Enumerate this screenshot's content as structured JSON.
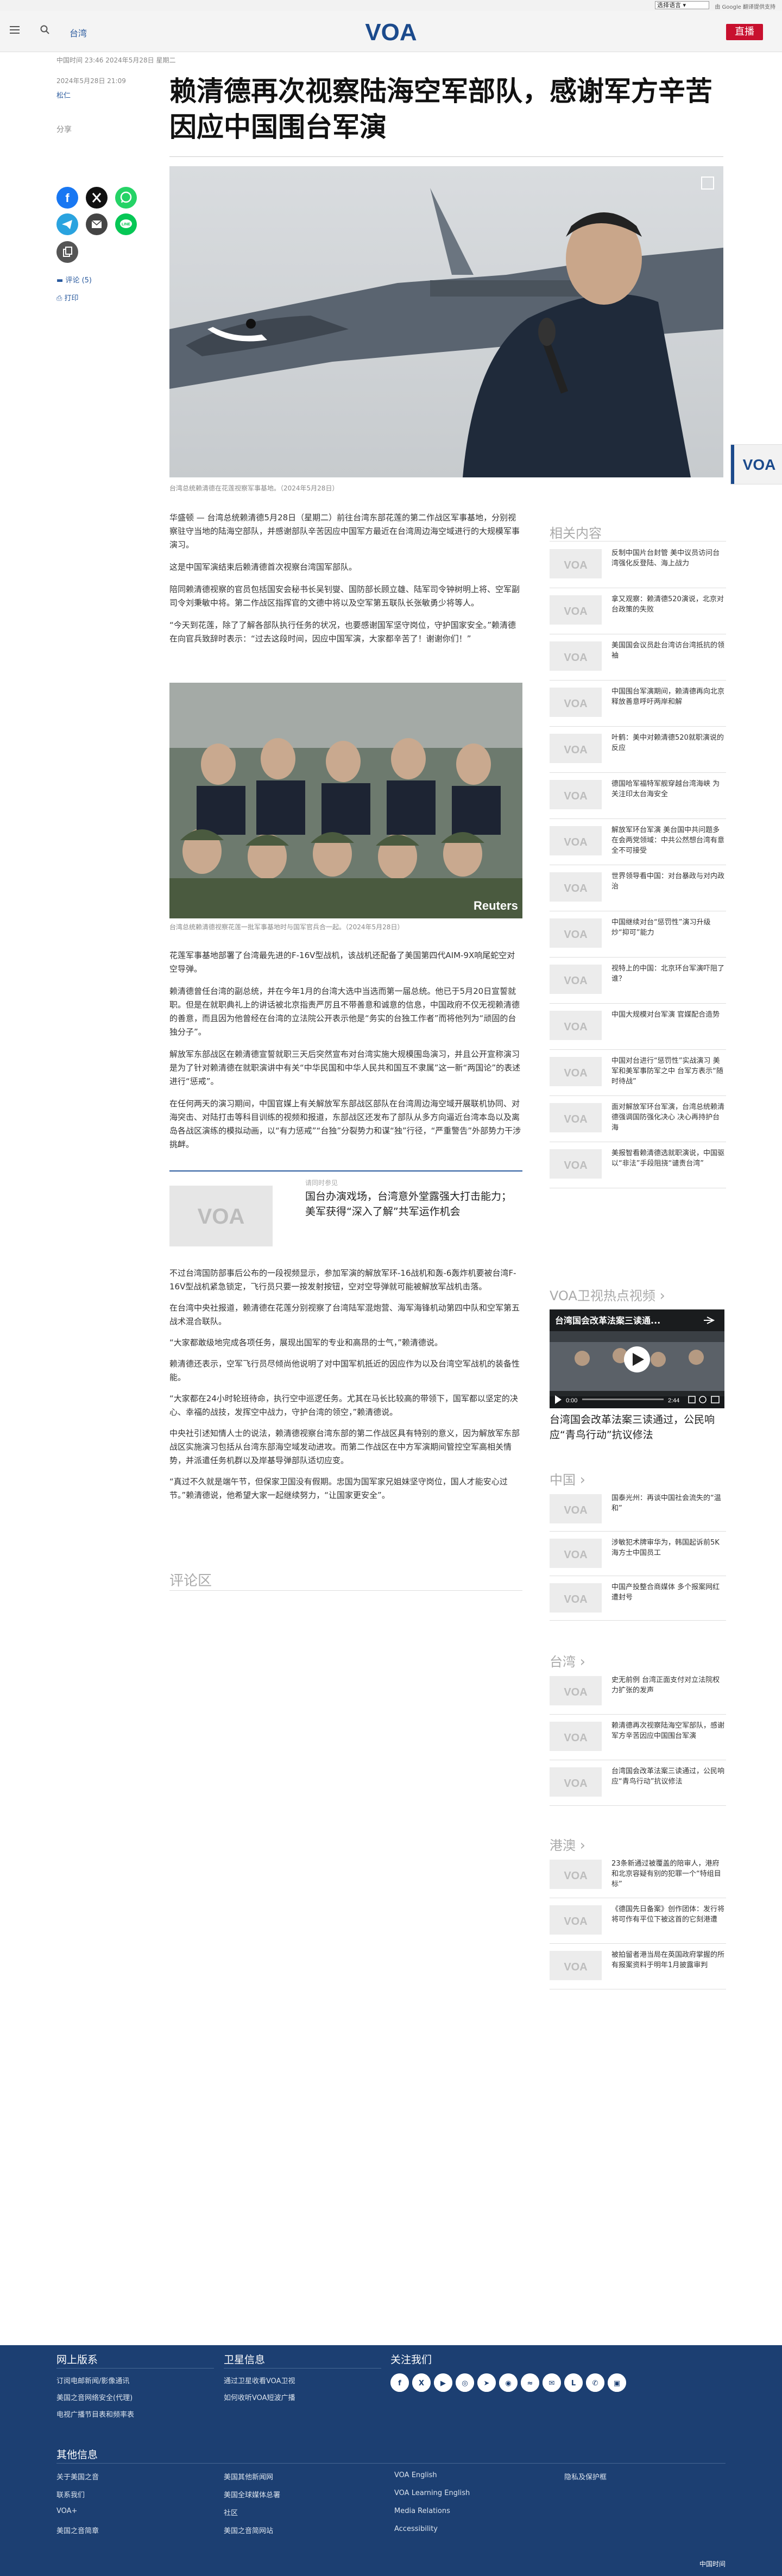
{
  "topbar": {
    "lang_select": "选择语言",
    "translate": "由 Google 翻译提供支持"
  },
  "header": {
    "section": "台湾",
    "logo": "VOA",
    "live": "直播"
  },
  "article": {
    "dateline": "中国时间 23:46 2024年5月28日 星期二",
    "pubdate": "2024年5月28日 21:09",
    "author": "松仁",
    "title": "赖清德再次视察陆海空军部队，感谢军方辛苦因应中国围台军演",
    "share_label": "分享",
    "comments": "评论 (5)",
    "print": "打印",
    "hero_caption": "台湾总统赖清德在花莲视察军事基地。（2024年5月28日）",
    "photo2_caption": "台湾总统赖清德视察花莲一批军事基地时与国军官兵合一起。（2024年5月28日）",
    "photo2_watermark": "Reuters",
    "paragraphs_a": [
      "华盛顿 — 台湾总统赖清德5月28日（星期二）前往台湾东部花莲的第二作战区军事基地，分别视察驻守当地的陆海空部队，并感谢部队辛苦因应中国军方最近在台湾周边海空域进行的大规模军事演习。",
      "这是中国军演结束后赖清德首次视察台湾国军部队。",
      "陪同赖清德视察的官员包括国安会秘书长吴钊燮、国防部长顾立雄、陆军司令钟树明上将、空军副司令刘秉敏中将。第二作战区指挥官的文德中将以及空军第五联队长张敏勇少将等人。",
      "“今天到花莲，除了了解各部队执行任务的状况，也要感谢国军坚守岗位，守护国家安全。”赖清德在向官兵致辞时表示：“过去这段时间，因应中国军演，大家都辛苦了！谢谢你们！”"
    ],
    "paragraphs_b": [
      "花莲军事基地部署了台湾最先进的F-16V型战机，该战机还配备了美国第四代AIM-9X响尾蛇空对空导弹。",
      "赖清德曾任台湾的副总统，并在今年1月的台湾大选中当选而第一届总统。他已于5月20日宣誓就职。但是在就职典礼上的讲话被北京指责严厉且不带善意和诚意的信息，中国政府不仅无视赖清德的善意，而且因为他曾经在台湾的立法院公开表示他是“务实的台独工作者”而将他列为“顽固的台独分子”。",
      "解放军东部战区在赖清德宣誓就职三天后突然宣布对台湾实施大规模围岛演习，并且公开宣称演习是为了针对赖清德在就职演讲中有关“中华民国和中华人民共和国互不隶属”这一新“两国论”的表述进行“惩戒”。",
      "在任何两天的演习期间，中国官媒上有关解放军东部战区部队在台湾周边海空域开展联机协同、对海突击、对陆打击等科目训练的视频和报道，东部战区还发布了部队从多方向逼近台湾本岛以及离岛各战区演练的模拟动画，以“有力惩戒”“台独”分裂势力和谋“独”行径，“严重警告”外部势力干涉挑衅。"
    ],
    "related": {
      "tag": "请同时参见",
      "title": "国台办演戏场，台湾意外堂露强大打击能力；美军获得“深入了解”共军运作机会",
      "thumb_logo": "VOA"
    },
    "paragraphs_c": [
      "不过台湾国防部事后公布的一段视频显示，参加军演的解放军环-16战机和轰-6轰炸机要被台湾F-16V型战机紧急锁定，飞行员只要一按发射按钮，空对空导弹就可能被解放军战机击落。",
      "在台湾中央社报道，赖清德在花莲分别视察了台湾陆军混炮营、海军海锋机动第四中队和空军第五战术混合联队。",
      "“大家都敢级地完成各项任务，展现出国军的专业和高昂的士气，”赖清德说。",
      "赖清德还表示，空军飞行员尽倾尚他说明了对中国军机抵近的因应作为以及台湾空军战机的装备性能。",
      "“大家都在24小时轮班待命，执行空中巡逻任务。尤其在马长比较高的带领下，国军都以坚定的决心、幸福的战技，发挥空中战力，守护台湾的领空，”赖清德说。",
      "中央社引述知情人士的说法，赖清德视察台湾东部的第二作战区具有特别的意义，因为解放军东部战区实施演习包括从台湾东部海空域发动进攻。而第二作战区在中方军演期间管控空军高相关情势，并派遣任务机群以及岸基导弹部队适切应变。",
      "“真过不久就是端午节，但保家卫国没有假期。忠国为国军家兄姐妹坚守岗位，国人才能安心过节。”赖清德说，他希望大家一起继续努力，“让国家更安全”。"
    ],
    "comment_heading": "评论区"
  },
  "sidebar": {
    "related_heading": "相关内容",
    "related_items": [
      "反制中国片台封管 美中议员访问台湾强化反登陆、海上战力",
      "拿又观察：赖清德520演说，北京对台政策的失败",
      "美国国会议员赴台湾访台湾抵抗的领袖",
      "中国围台军演期间，赖清德再向北京释放善意呼吁两岸和解",
      "叶鹤：美中对赖清德520就职演说的反应",
      "德国哈军福特军舰穿越台湾海峡 为 关注印太台海安全",
      "解放军环台军演 美台国中共问题多在会两党领域：中共公然想台湾有意全不可接受",
      "世界领导看中国：对台暴政与对内政治",
      "中国继续对台“惩罚性”演习升级炒“抑可”能力",
      "视特上的中国：北京环台军演吓阻了谁？",
      "中国大规模对台军演 官媒配合造势",
      "中国对台进行“惩罚性”实战演习 美军和美军事防军之中 台军方表示“随时待战”",
      "面对解放军环台军演，台湾总统赖清德强调国防强化决心 决心再持护台海",
      "美报智看赖清德选就职演说，中国驱以“非法”手段阻挠“谴责台湾”"
    ],
    "video_heading": "VOA卫视热点视频",
    "video_overlay": "台湾国会改革法案三读通...",
    "video_logo": "VOA",
    "video_time": "0:00",
    "video_duration": "2:44",
    "video_title": "台湾国会改革法案三读通过，公民响应“青鸟行动”抗议修法",
    "china_heading": "中国",
    "china_items": [
      "国泰光州：再谈中国社会流失的“温和”",
      "涉敏犯术牌审华为，韩国起诉前5K海方士中国员工",
      "中国产投整合商媒体 多个报案网红遭封号"
    ],
    "taiwan_heading": "台湾",
    "taiwan_items": [
      "史无前例 台湾正面支付对立法院权力扩张的发声",
      "赖清德再次视察陆海空军部队，感谢军方辛苦因应中国围台军演",
      "台湾国会改革法案三读通过，公民响应“青鸟行动”抗议修法"
    ],
    "hk_heading": "港澳",
    "hk_items": [
      "23条新通过被覆盖的陪审人，港府和北京容疑有别的犯罪一个“特组目标”",
      "《德国先日备案》创作团体：发行将将可作有平位下被这首的它刻港遭",
      "被拍留者港当局在英国政府掌握的所有报案资料于明年1月披露审判"
    ]
  },
  "footer": {
    "col1_heading": "网上版系",
    "col1_links": [
      "订阅电邮新闻/影像通讯",
      "美国之音网络安全(代理)",
      "电视广播节目表和频率表"
    ],
    "col2_heading": "卫星信息",
    "col2_links": [
      "通过卫星收看VOA卫视",
      "如何收听VOA短波广播"
    ],
    "col3_heading": "关注我们",
    "social": [
      "facebook-icon",
      "x-icon",
      "youtube-icon",
      "instagram-icon",
      "telegram-icon",
      "podcast-icon",
      "rss-icon",
      "email-icon",
      "line-icon",
      "whatsapp-icon",
      "app-icon"
    ],
    "other_heading": "其他信息",
    "other_cols": [
      [
        "关于美国之音",
        "联系我们",
        "VOA+",
        "美国之音简章"
      ],
      [
        "美国其他新闻网",
        "美国全球媒体总署",
        "社区",
        "美国之音简网站"
      ],
      [
        "VOA English",
        "VOA Learning English",
        "Media Relations",
        "Accessibility"
      ],
      [
        "隐私及保护框"
      ]
    ],
    "copyright": "中国时间"
  }
}
